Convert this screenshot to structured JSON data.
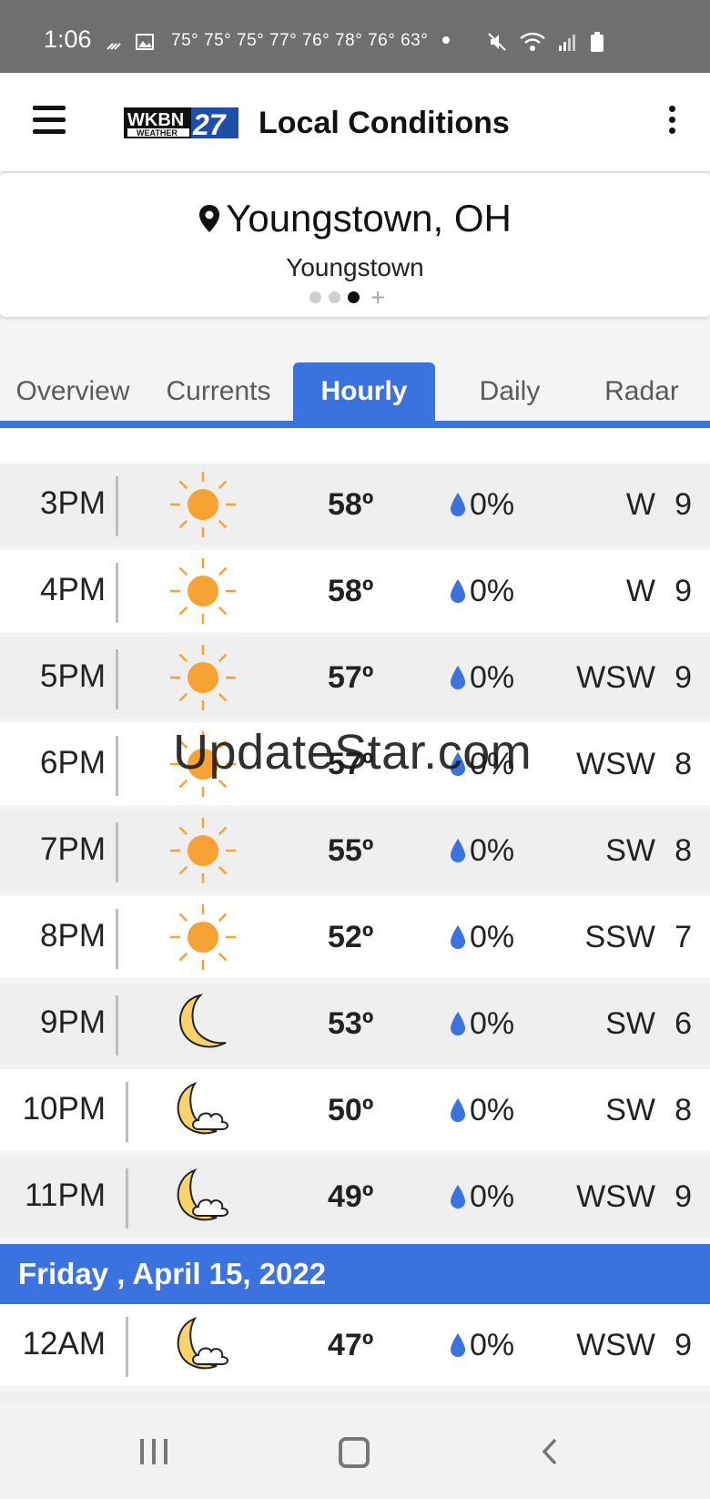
{
  "status_bar": {
    "time": "1:06",
    "temps": "75° 75° 75° 77° 76° 78° 76° 63°"
  },
  "app_bar": {
    "logo_text": "WKBN",
    "logo_sub": "WEATHER",
    "logo_number": "27",
    "title": "Local Conditions"
  },
  "location": {
    "name": "Youngstown, OH",
    "subtitle": "Youngstown",
    "pages": 3,
    "active_page": 3
  },
  "tabs": [
    {
      "label": "Overview",
      "active": false
    },
    {
      "label": "Currents",
      "active": false
    },
    {
      "label": "Hourly",
      "active": true
    },
    {
      "label": "Daily",
      "active": false
    },
    {
      "label": "Radar",
      "active": false
    }
  ],
  "hourly": [
    {
      "hour": "3PM",
      "icon": "sun-icon",
      "temp": "58º",
      "precip": "0%",
      "wind_dir": "W",
      "wind_speed": "9"
    },
    {
      "hour": "4PM",
      "icon": "sun-icon",
      "temp": "58º",
      "precip": "0%",
      "wind_dir": "W",
      "wind_speed": "9"
    },
    {
      "hour": "5PM",
      "icon": "sun-icon",
      "temp": "57º",
      "precip": "0%",
      "wind_dir": "WSW",
      "wind_speed": "9"
    },
    {
      "hour": "6PM",
      "icon": "sun-icon",
      "temp": "57º",
      "precip": "0%",
      "wind_dir": "WSW",
      "wind_speed": "8"
    },
    {
      "hour": "7PM",
      "icon": "sun-icon",
      "temp": "55º",
      "precip": "0%",
      "wind_dir": "SW",
      "wind_speed": "8"
    },
    {
      "hour": "8PM",
      "icon": "sun-icon",
      "temp": "52º",
      "precip": "0%",
      "wind_dir": "SSW",
      "wind_speed": "7"
    },
    {
      "hour": "9PM",
      "icon": "moon-icon",
      "temp": "53º",
      "precip": "0%",
      "wind_dir": "SW",
      "wind_speed": "6"
    },
    {
      "hour": "10PM",
      "icon": "moon-cloud-icon",
      "temp": "50º",
      "precip": "0%",
      "wind_dir": "SW",
      "wind_speed": "8"
    },
    {
      "hour": "11PM",
      "icon": "moon-cloud-icon",
      "temp": "49º",
      "precip": "0%",
      "wind_dir": "WSW",
      "wind_speed": "9"
    }
  ],
  "day_header": "Friday , April 15, 2022",
  "next_day": [
    {
      "hour": "12AM",
      "icon": "moon-cloud-icon",
      "temp": "47º",
      "precip": "0%",
      "wind_dir": "WSW",
      "wind_speed": "9"
    }
  ],
  "watermark": "UpdateStar.com",
  "colors": {
    "accent": "#3a73e0",
    "sun": "#f7a334",
    "moon": "#f8d36a",
    "drop": "#3a73e0"
  }
}
